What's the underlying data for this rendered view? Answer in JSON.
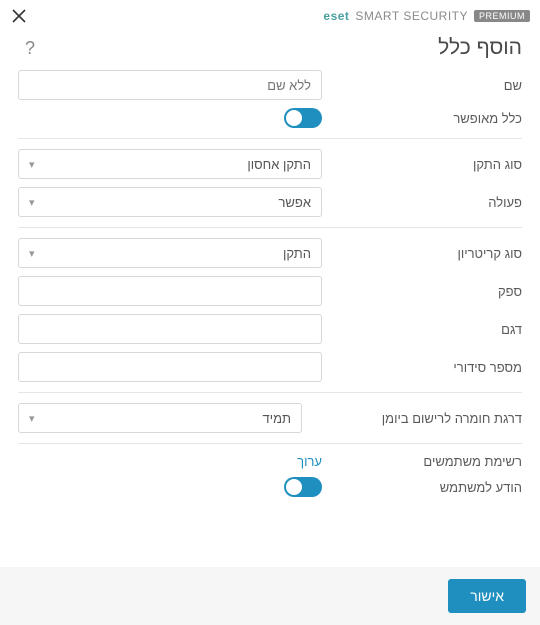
{
  "brand": {
    "eset": "eset",
    "product": "SMART SECURITY",
    "premium": "PREMIUM"
  },
  "dialog": {
    "title": "הוסף כלל",
    "help_tooltip": "?",
    "fields": {
      "name_label": "שם",
      "name_placeholder": "ללא שם",
      "enabled_label": "כלל מאופשר",
      "device_type_label": "סוג התקן",
      "device_type_value": "התקן אחסון",
      "action_label": "פעולה",
      "action_value": "אפשר",
      "criterion_type_label": "סוג קריטריון",
      "criterion_type_value": "התקן",
      "vendor_label": "ספק",
      "model_label": "דגם",
      "serial_label": "מספר סידורי",
      "severity_label": "דרגת חומרה לרישום ביומן",
      "severity_value": "תמיד",
      "users_label": "רשימת משתמשים",
      "users_edit": "ערוך",
      "notify_label": "הודע למשתמש"
    },
    "footer": {
      "ok": "אישור"
    },
    "state": {
      "enabled": true,
      "notify": true
    }
  }
}
